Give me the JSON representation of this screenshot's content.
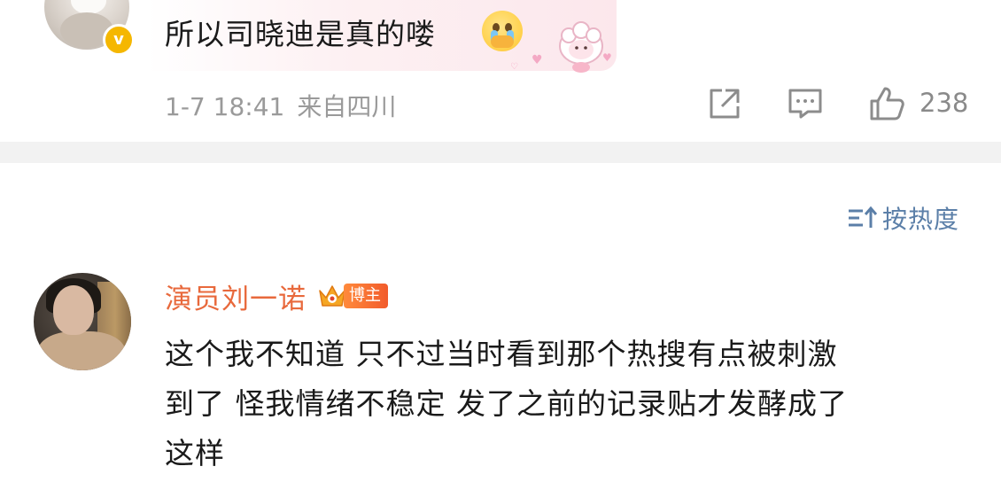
{
  "top_comment": {
    "text": "所以司晓迪是真的喽",
    "emoji_icon": "crying-face-emoji",
    "sticker": "sheep-sticker",
    "time": "1-7 18:41",
    "location": "来自四川",
    "like_count": "238",
    "verified_badge": "v"
  },
  "sort": {
    "label": "按热度",
    "icon": "sort-icon"
  },
  "second_comment": {
    "username": "演员刘一诺",
    "badge_label": "博主",
    "lines": [
      "这个我不知道 只不过当时看到那个热搜有点被刺激",
      "到了 怪我情绪不稳定 发了之前的记录贴才发酵成了",
      "这样"
    ]
  },
  "colors": {
    "username": "#e8693c",
    "sort_link": "#5b7fa8",
    "meta": "#9a9a9a",
    "separator": "#f2f2f2",
    "badge": "#f25b2b"
  }
}
